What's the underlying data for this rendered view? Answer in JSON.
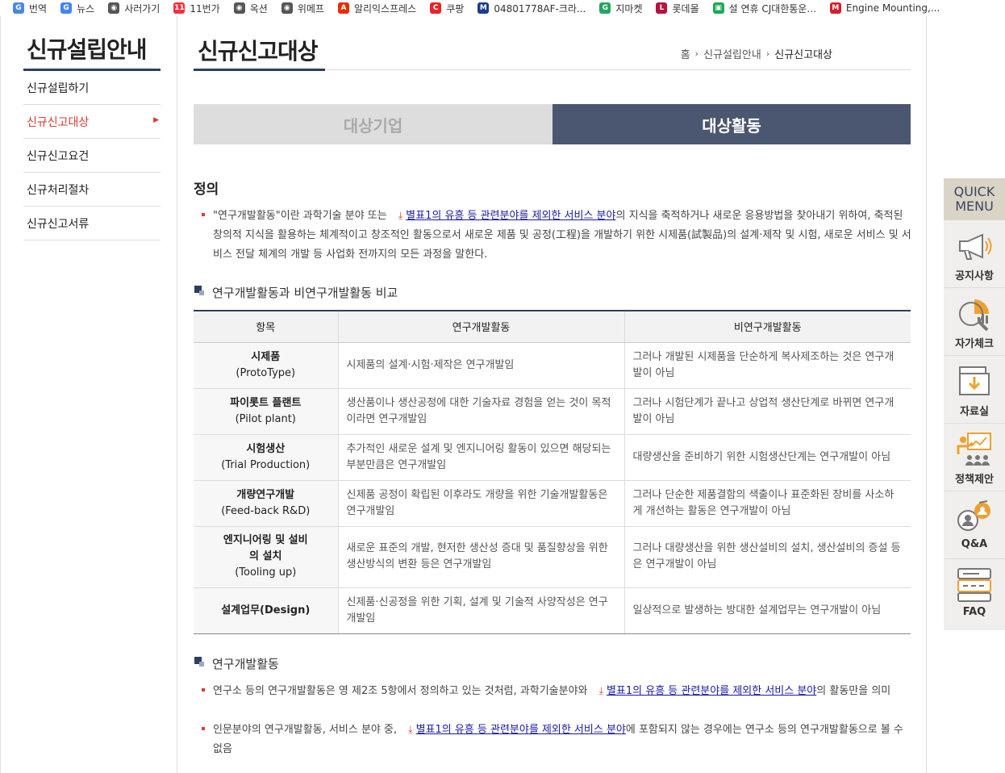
{
  "bookmarks": [
    {
      "label": "번역",
      "color": "#4a86e8",
      "glyph": "G"
    },
    {
      "label": "뉴스",
      "color": "#4285f4",
      "glyph": "G"
    },
    {
      "label": "사러가기",
      "color": "#555555",
      "glyph": "◉"
    },
    {
      "label": "11번가",
      "color": "#f43142",
      "glyph": "11"
    },
    {
      "label": "옥션",
      "color": "#555555",
      "glyph": "◉"
    },
    {
      "label": "위메프",
      "color": "#555555",
      "glyph": "◉"
    },
    {
      "label": "알리익스프레스",
      "color": "#e62e04",
      "glyph": "A"
    },
    {
      "label": "쿠팡",
      "color": "#e52528",
      "glyph": "C"
    },
    {
      "label": "04801778AF-크라...",
      "color": "#1b3c8e",
      "glyph": "M"
    },
    {
      "label": "지마켓",
      "color": "#25a55f",
      "glyph": "G"
    },
    {
      "label": "롯데몰",
      "color": "#b5123e",
      "glyph": "L"
    },
    {
      "label": "설 연휴 CJ대한통운...",
      "color": "#1aaa55",
      "glyph": "▣"
    },
    {
      "label": "Engine Mounting,...",
      "color": "#d3202e",
      "glyph": "M"
    }
  ],
  "lnb": {
    "title": "신규설립안내",
    "items": [
      {
        "label": "신규설립하기",
        "active": false
      },
      {
        "label": "신규신고대상",
        "active": true
      },
      {
        "label": "신규신고요건",
        "active": false
      },
      {
        "label": "신규처리절차",
        "active": false
      },
      {
        "label": "신규신고서류",
        "active": false
      }
    ]
  },
  "page": {
    "title": "신규신고대상",
    "breadcrumb": [
      "홈",
      "신규설립안내",
      "신규신고대상"
    ]
  },
  "tabs": [
    {
      "label": "대상기업",
      "active": false
    },
    {
      "label": "대상활동",
      "active": true
    }
  ],
  "definition": {
    "heading": "정의",
    "text_before": "\"연구개발활동\"이란 과학기술 분야 또는 ",
    "link": "별표1의 유흥 등 관련분야를 제외한 서비스 분야",
    "text_after": "의 지식을 축적하거나 새로운 응용방법을 찾아내기 위하여, 축적된 창의적 지식을 활용하는 체계적이고 창조적인 활동으로서 새로운 제품 및 공정(工程)을 개발하기 위한 시제품(試製品)의 설계·제작 및 시험, 새로운 서비스 및 서비스 전달 체계의 개발 등 사업화 전까지의 모든 과정을 말한다."
  },
  "comparison": {
    "heading": "연구개발활동과 비연구개발활동 비교",
    "columns": [
      "항목",
      "연구개발활동",
      "비연구개발활동"
    ],
    "rows": [
      {
        "item": "시제품",
        "item_en": "(ProtoType)",
        "rd": "시제품의 설계·시험·제작은 연구개발임",
        "non_rd": "그러나 개발된 시제품을 단순하게 복사제조하는 것은 연구개발이 아님"
      },
      {
        "item": "파이롯트 플랜트",
        "item_en": "(Pilot plant)",
        "rd": "생산품이나 생산공정에 대한 기술자료 경험을 얻는 것이 목적이라면 연구개발임",
        "non_rd": "그러나 시험단계가 끝나고 상업적 생산단계로 바뀌면 연구개발이 아님"
      },
      {
        "item": "시험생산",
        "item_en": "(Trial Production)",
        "rd": "추가적인 새로운 설계 및 엔지니어링 활동이 있으면 해당되는 부분만큼은 연구개발임",
        "non_rd": "대량생산을 준비하기 위한 시험생산단계는 연구개발이 아님"
      },
      {
        "item": "개량연구개발",
        "item_en": "(Feed-back R&D)",
        "rd": "신제품 공정이 확립된 이후라도 개량을 위한 기술개발활동은 연구개발임",
        "non_rd": "그러나 단순한 제품결함의 색출이나 표준화된 장비를 사소하게 개선하는 활동은 연구개발이 아님"
      },
      {
        "item": "엔지니어링 및 설비의 설치",
        "item_en": "(Tooling up)",
        "rd": "새로운 표준의 개발, 현저한 생산성 증대 및 품질향상을 위한 생산방식의 변환 등은 연구개발임",
        "non_rd": "그러나 대량생산을 위한 생산설비의 설치, 생산설비의 증설 등은 연구개발이 아님"
      },
      {
        "item": "설계업무(Design)",
        "item_en": "",
        "rd": "신제품·신공정을 위한 기획, 설계 및 기술적 사양작성은 연구개발임",
        "non_rd": "일상적으로 발생하는 방대한 설계업무는 연구개발이 아님"
      }
    ]
  },
  "rnd": {
    "heading": "연구개발활동",
    "items": [
      {
        "before": "연구소 등의 연구개발활동은 영 제2조 5항에서 정의하고 있는 것처럼, 과학기술분야와 ",
        "link": "별표1의 유흥 등 관련분야를 제외한 서비스 분야",
        "after": "의 활동만을 의미"
      },
      {
        "before": "인문분야의 연구개발활동, 서비스 분야 중, ",
        "link": "별표1의 유흥 등 관련분야를 제외한 서비스 분야",
        "after": "에 포함되지 않는 경우에는 연구소 등의 연구개발활동으로 볼 수 없음"
      }
    ]
  },
  "quick_menu": {
    "title_line1": "QUICK",
    "title_line2": "MENU",
    "items": [
      "공지사항",
      "자가체크",
      "자료실",
      "정책제안",
      "Q&A",
      "FAQ"
    ]
  },
  "colors": {
    "accent_navy": "#2e3d62",
    "active_red": "#d93b30",
    "tab_active_bg": "#4b5770",
    "quick_orange": "#f0a030"
  }
}
